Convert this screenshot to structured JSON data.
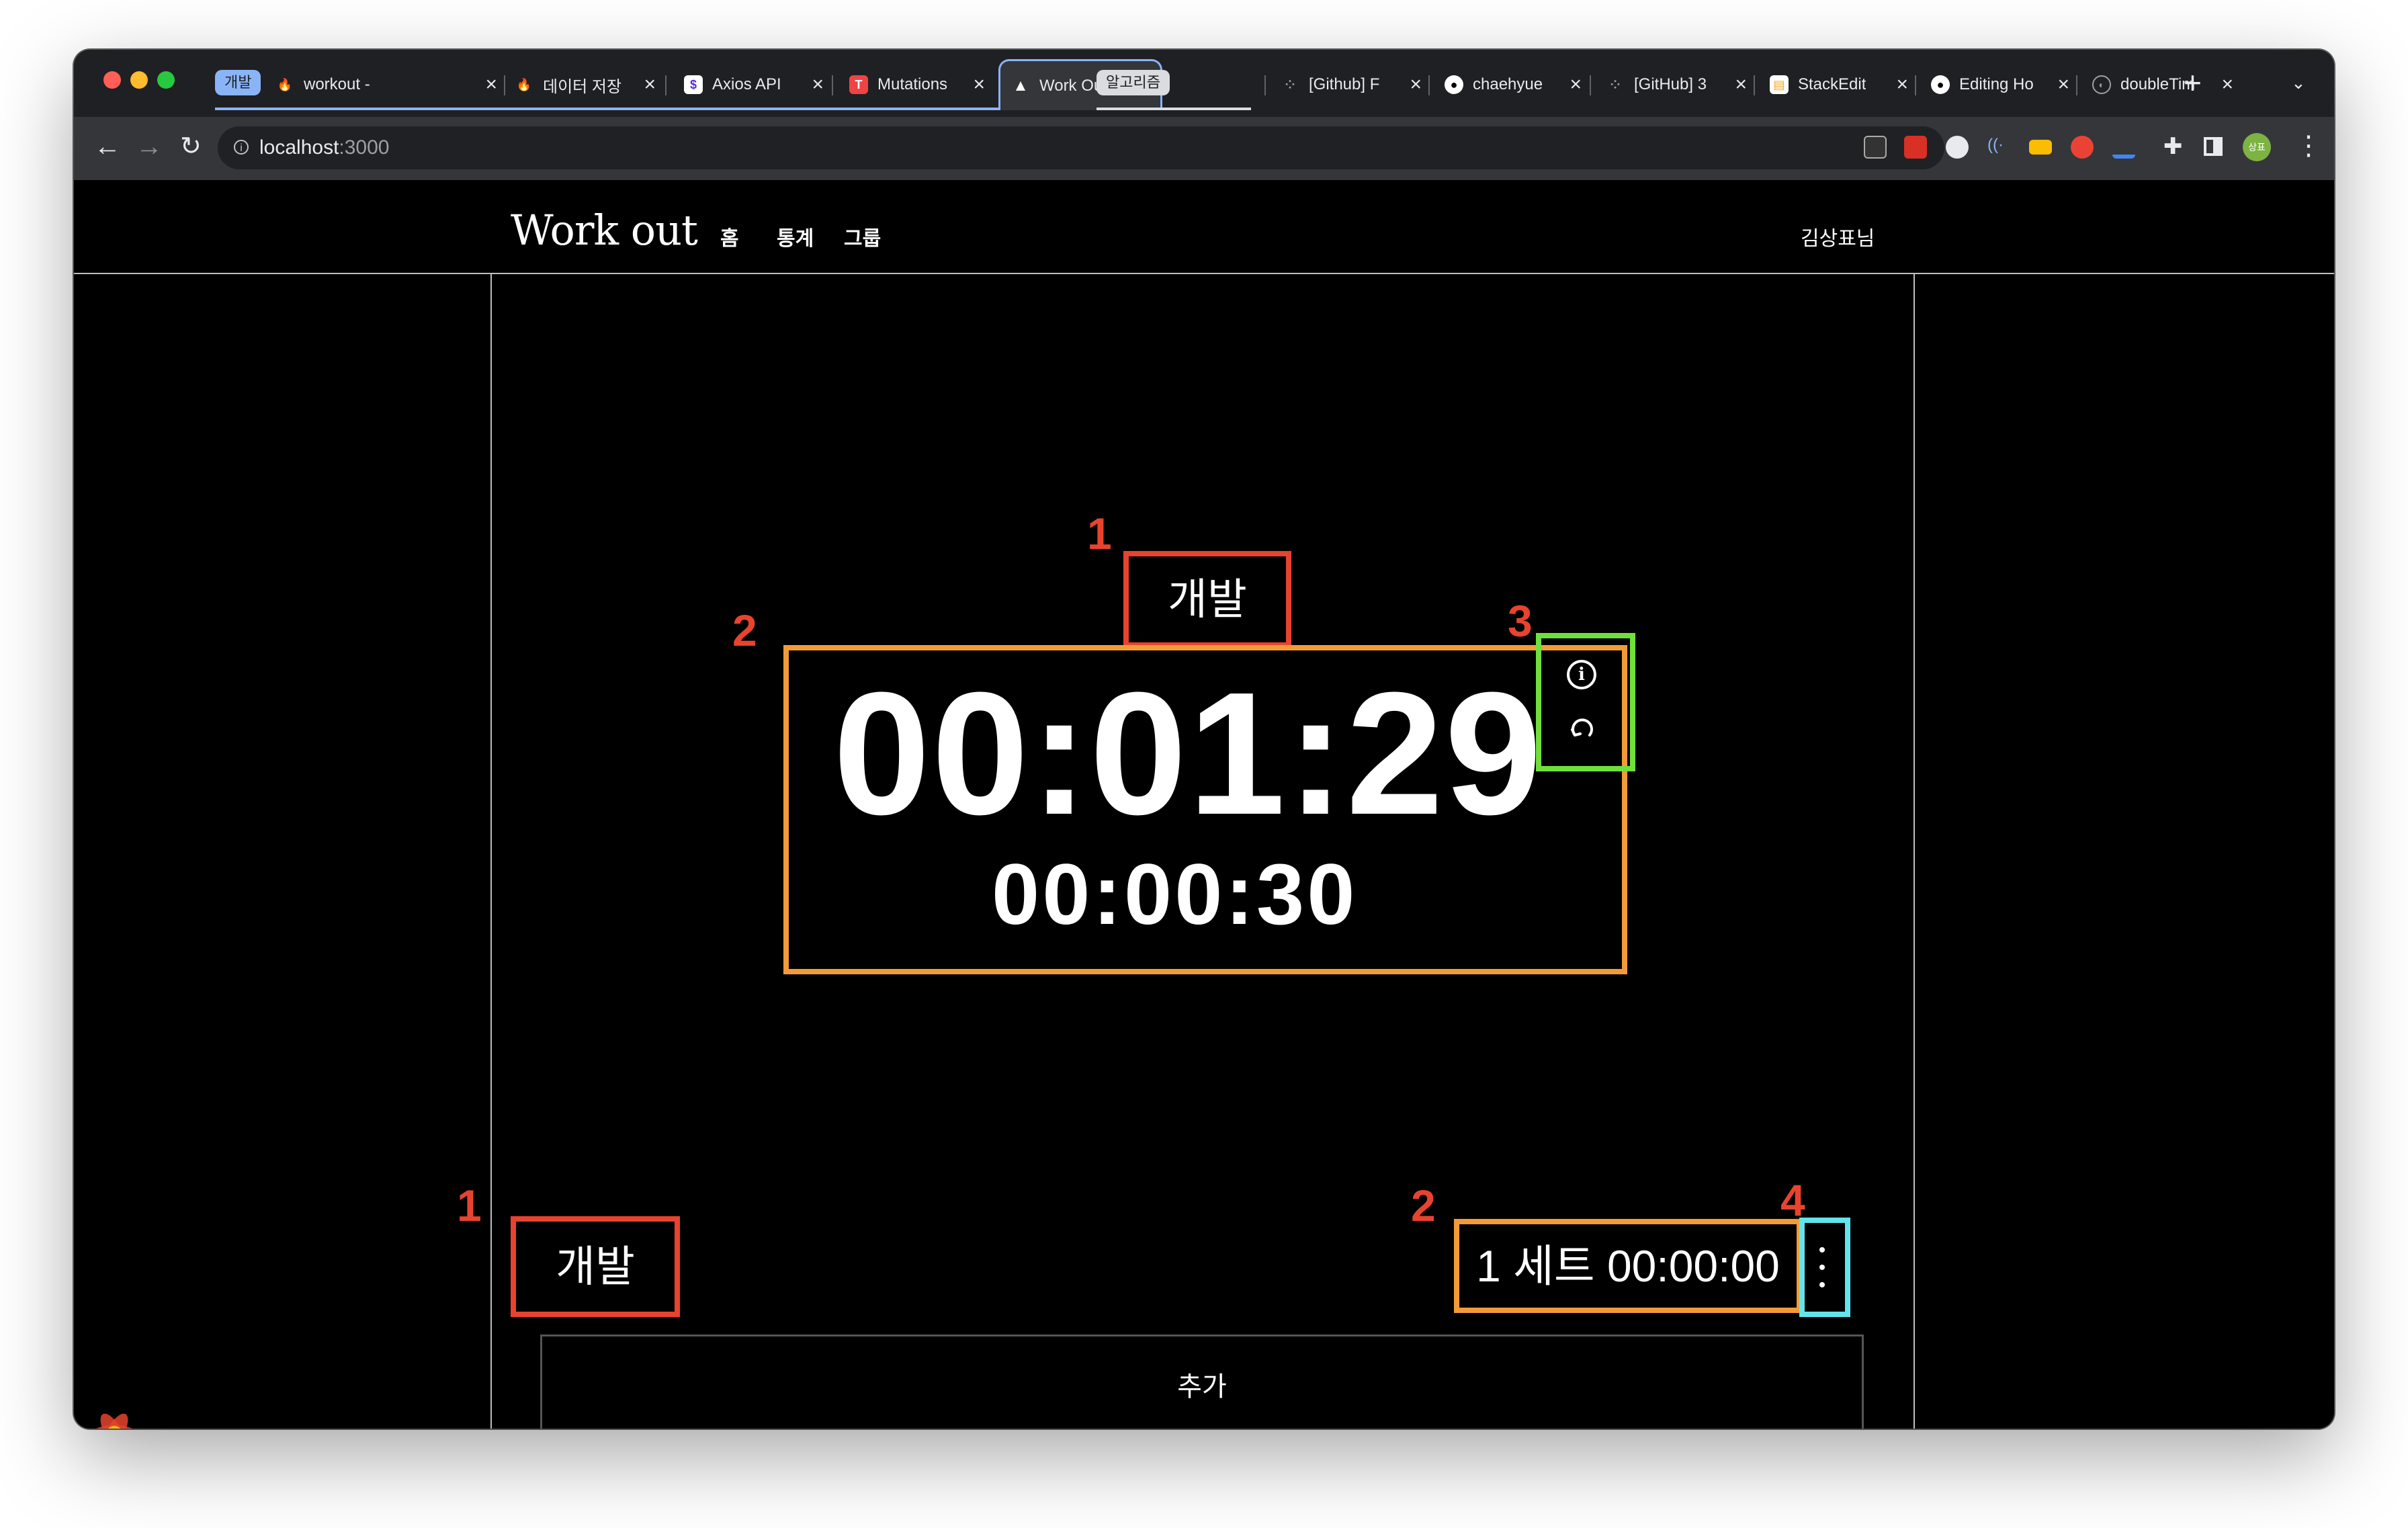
{
  "browser": {
    "tab_groups": [
      {
        "label": "개발",
        "color": "#8ab4f8"
      },
      {
        "label": "알고리즘",
        "color": "#dadce0"
      }
    ],
    "tabs": [
      {
        "title": "workout -",
        "icon": "firebase-icon"
      },
      {
        "title": "데이터 저장",
        "icon": "firebase-icon"
      },
      {
        "title": "Axios API",
        "icon": "axios-icon"
      },
      {
        "title": "Mutations",
        "icon": "tanstack-icon"
      },
      {
        "title": "Work Out",
        "icon": "vercel-icon",
        "active": true
      },
      {
        "title": "[Github] F",
        "icon": "dots-icon"
      },
      {
        "title": "chaehyue",
        "icon": "github-icon"
      },
      {
        "title": "[GitHub] 3",
        "icon": "dots-icon"
      },
      {
        "title": "StackEdit",
        "icon": "stackedit-icon"
      },
      {
        "title": "Editing Ho",
        "icon": "github-icon"
      },
      {
        "title": "doubleTim",
        "icon": "globe-icon"
      }
    ],
    "url_host": "localhost",
    "url_port": ":3000",
    "profile_initials": "상표"
  },
  "app": {
    "logo": "Work out",
    "nav": {
      "home": "홈",
      "stats": "통계",
      "group": "그룹"
    },
    "user_name": "김상표님"
  },
  "timer": {
    "category": "개발",
    "main_time": "00:01:29",
    "sub_time": "00:00:30"
  },
  "annotations": {
    "timer_category": "1",
    "timer_box": "2",
    "timer_actions": "3",
    "row_category": "1",
    "row_set_info": "2",
    "row_menu": "4"
  },
  "record_row": {
    "category": "개발",
    "set_info": "1 세트 00:00:00"
  },
  "add_button_label": "추가",
  "colors": {
    "annotation_red": "#e8432e",
    "annotation_orange": "#f29b38",
    "annotation_green": "#6fe03b",
    "annotation_cyan": "#62e4ec"
  }
}
